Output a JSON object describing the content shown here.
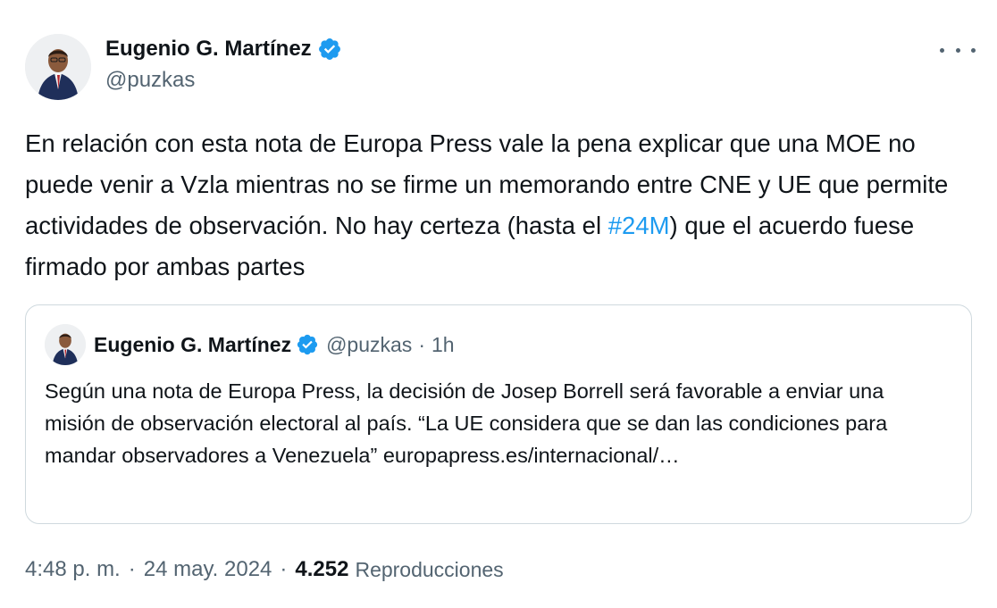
{
  "tweet": {
    "author": {
      "name": "Eugenio G. Martínez",
      "handle": "@puzkas",
      "verified_icon": "verified-badge-icon",
      "verified_color": "#1d9bf0"
    },
    "more_icon": "more-options-icon",
    "text_before": "En relación con esta nota de Europa Press vale la pena explicar que una MOE no puede venir a Vzla mientras no se firme un memorando entre CNE y UE que permite actividades de observación. No hay certeza (hasta el ",
    "hashtag": "#24M",
    "text_after": ") que el acuerdo fuese firmado por ambas partes",
    "hashtag_color": "#1d9bf0",
    "time": "4:48 p. m.",
    "separator": "·",
    "date": "24 may. 2024",
    "views_count": "4.252",
    "views_label": "Reproducciones"
  },
  "quoted": {
    "author": {
      "name": "Eugenio G. Martínez",
      "handle": "@puzkas",
      "verified_icon": "verified-badge-icon"
    },
    "separator": "·",
    "time_ago": "1h",
    "text": "Según una nota de Europa Press, la decisión de Josep Borrell será favorable a enviar una misión de observación electoral al país. “La UE considera que se dan las condiciones para mandar observadores a Venezuela”",
    "link": "europapress.es/internacional/…"
  }
}
